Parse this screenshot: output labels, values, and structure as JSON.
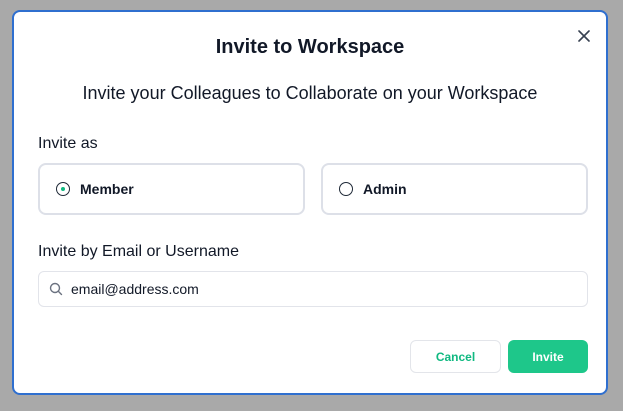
{
  "dialog": {
    "title": "Invite to Workspace",
    "subtitle": "Invite your Colleagues to Collaborate on your Workspace",
    "close_icon": "close-icon"
  },
  "invite_as": {
    "label": "Invite as",
    "options": [
      {
        "label": "Member",
        "selected": true
      },
      {
        "label": "Admin",
        "selected": false
      }
    ]
  },
  "invite_by": {
    "label": "Invite by Email or Username",
    "icon": "search-icon",
    "value": "email@address.com"
  },
  "actions": {
    "cancel_label": "Cancel",
    "invite_label": "Invite"
  },
  "colors": {
    "accent": "#1ec78a",
    "border_focus": "#2f6fcf"
  }
}
